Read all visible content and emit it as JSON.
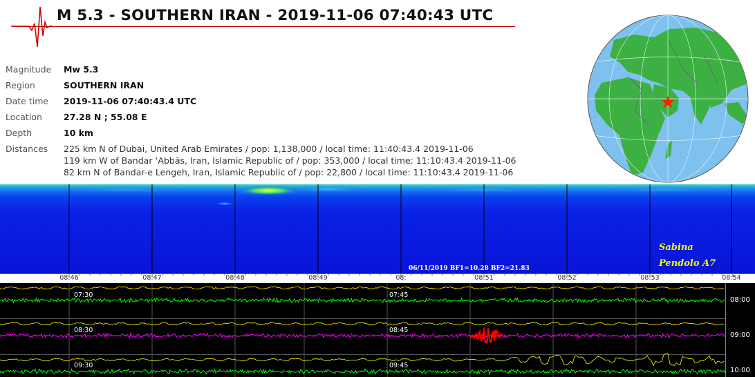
{
  "header": {
    "title": "M 5.3 - SOUTHERN IRAN - 2019-11-06 07:40:43 UTC",
    "accent_color": "#c00000"
  },
  "logo": {
    "icon": "seismograph-logo-icon"
  },
  "info": {
    "magnitude": {
      "label": "Magnitude",
      "value": "Mw 5.3"
    },
    "region": {
      "label": "Region",
      "value": "SOUTHERN IRAN"
    },
    "datetime": {
      "label": "Date time",
      "value": "2019-11-06 07:40:43.4 UTC"
    },
    "location": {
      "label": "Location",
      "value": "27.28 N ; 55.08 E"
    },
    "depth": {
      "label": "Depth",
      "value": "10 km"
    },
    "distances": {
      "label": "Distances",
      "lines": [
        "225 km N of Dubai, United Arab Emirates / pop: 1,138,000 / local time: 11:40:43.4 2019-11-06",
        "119 km W of Bandar ‘Abbās, Iran, Islamic Republic of / pop: 353,000 / local time: 11:10:43.4 2019-11-06",
        "82 km N of Bandar-e Lengeh, Iran, Islamic Republic of / pop: 22,800 / local time: 11:10:43.4 2019-11-06"
      ]
    }
  },
  "globe": {
    "icon": "globe-map-icon",
    "epicenter_marker": "star-icon",
    "ocean_color": "#7ec0ee",
    "land_color": "#3cb043",
    "marker_color": "#ff2000"
  },
  "spectrogram": {
    "station_line1": "Sabina",
    "station_line2": "Pendolo A7",
    "filter_info": "06/11/2019 BF1=10.28 BF2=21.83",
    "background_color": "#0a1ee8",
    "label_color": "#ffff00"
  },
  "time_axis": {
    "ticks": [
      "08:46",
      "08:47",
      "08:48",
      "08:49",
      "08:",
      "08:51",
      "08:52",
      "08:53",
      "08:54"
    ]
  },
  "drum": {
    "rows": [
      {
        "start_label": "07:30",
        "mid_label": "07:45",
        "hour_label": "08:00",
        "trace_color": "#00ff00"
      },
      {
        "start_label": "08:30",
        "mid_label": "08:45",
        "hour_label": "09:00",
        "trace_color": "#ff00ff"
      },
      {
        "start_label": "09:30",
        "mid_label": "09:45",
        "hour_label": "10:00",
        "trace_color": "#00ff00"
      }
    ],
    "event_color": "#ff0000",
    "filtered_trace_color": "#ffff00"
  }
}
